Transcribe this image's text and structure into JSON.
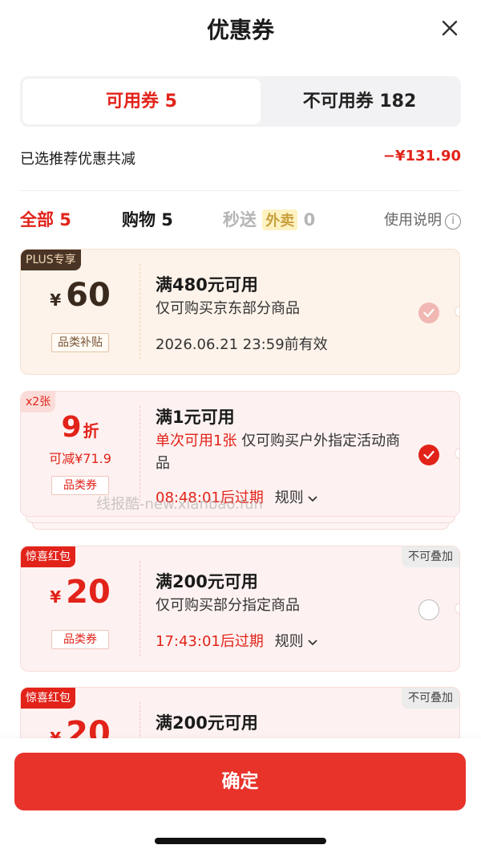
{
  "header": {
    "title": "优惠券",
    "close_icon": "close-icon"
  },
  "tabs": [
    {
      "label": "可用券 5",
      "active": true
    },
    {
      "label": "不可用券 182",
      "active": false
    }
  ],
  "summary": {
    "label": "已选推荐优惠共减",
    "amount": "−¥131.90"
  },
  "filters": {
    "all": "全部 5",
    "shopping": "购物 5",
    "fast_prefix": "秒送",
    "fast_tag": "外卖",
    "fast_count": "0",
    "usage": "使用说明",
    "info_glyph": "i"
  },
  "coupons": [
    {
      "badge": "PLUS专享",
      "yen": "¥",
      "value": "60",
      "tag": "品类补贴",
      "title": "满480元可用",
      "desc": "仅可购买京东部分商品",
      "expiry": "2026.06.21 23:59前有效",
      "state": "selected-faded"
    },
    {
      "badge": "x2张",
      "value": "9",
      "unit": "折",
      "sub": "可减¥71.9",
      "tag": "品类券",
      "title": "满1元可用",
      "desc_highlight": "单次可用1张",
      "desc": "仅可购买户外指定活动商品",
      "countdown": "08:48:01后过期",
      "rules": "规则",
      "state": "selected"
    },
    {
      "badge": "惊喜红包",
      "nostack": "不可叠加",
      "yen": "¥",
      "value": "20",
      "tag": "品类券",
      "title": "满200元可用",
      "desc": "仅可购买部分指定商品",
      "countdown": "17:43:01后过期",
      "rules": "规则",
      "state": "unselected"
    },
    {
      "badge": "惊喜红包",
      "nostack": "不可叠加",
      "yen": "¥",
      "value": "20",
      "title": "满200元可用"
    }
  ],
  "watermark": "线报酷-new.xianbao.fun",
  "footer": {
    "confirm_label": "确定"
  },
  "colors": {
    "accent": "#e2231a",
    "button": "#e8332b"
  }
}
